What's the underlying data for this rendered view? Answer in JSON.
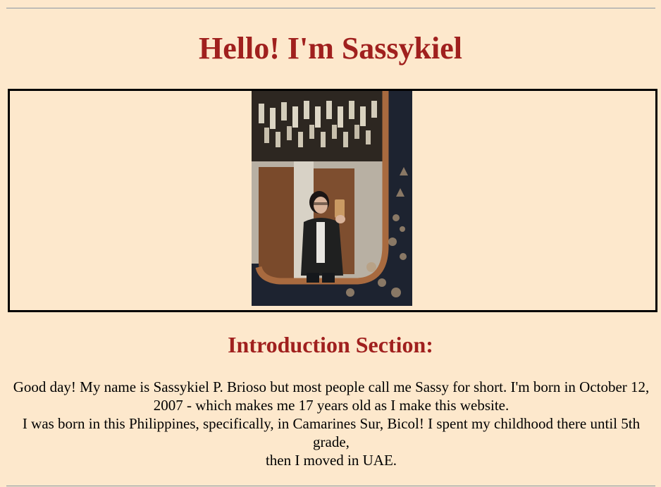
{
  "header": {
    "title": "Hello! I'm Sassykiel"
  },
  "photo": {
    "alt": "Mirror selfie of Sassykiel"
  },
  "intro": {
    "heading": "Introduction Section:",
    "line1": "Good day! My name is Sassykiel P. Brioso but most people call me Sassy for short. I'm born in October 12, 2007 - which makes me 17 years old as I make this website.",
    "line2": "I was born in this Philippines, specifically, in Camarines Sur, Bicol! I spent my childhood there until 5th grade,",
    "line3": "then I moved in UAE."
  },
  "colors": {
    "background": "#fde8cc",
    "heading": "#a0201e",
    "frame_border": "#000000",
    "rule": "#8a97a3"
  }
}
